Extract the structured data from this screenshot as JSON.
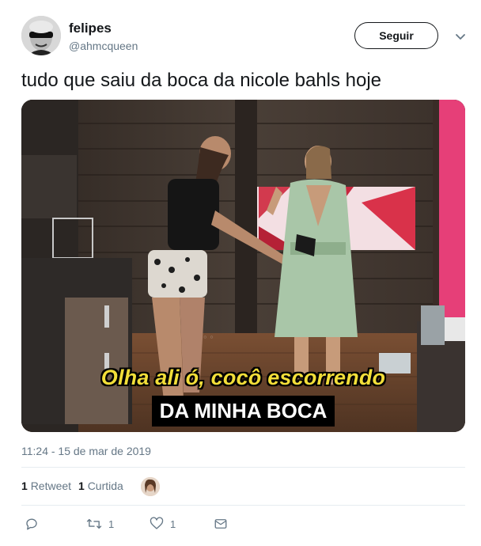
{
  "user": {
    "name": "felipes",
    "handle": "@ahmcqueen"
  },
  "follow_label": "Seguir",
  "tweet": {
    "text": "tudo que saiu da boca da nicole bahls hoje"
  },
  "media": {
    "caption_line1": "Olha ali ó, cocô escorrendo",
    "caption_line2": "DA MINHA BOCA"
  },
  "timestamp": "11:24 - 15 de mar de 2019",
  "stats": {
    "retweets_count": "1",
    "retweets_label": "Retweet",
    "likes_count": "1",
    "likes_label": "Curtida"
  },
  "actions": {
    "reply_count": "",
    "retweet_count": "1",
    "like_count": "1"
  },
  "colors": {
    "text": "#14171a",
    "secondary": "#657786",
    "divider": "#e6ecf0",
    "caption_yellow": "#f2de39"
  }
}
